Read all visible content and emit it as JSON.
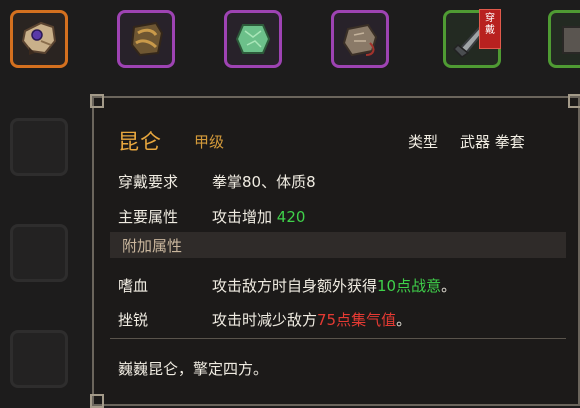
{
  "inventory": {
    "slots": [
      {
        "rarity": "orange",
        "icon": "glove-icon"
      },
      {
        "rarity": "purple",
        "icon": "armor-icon"
      },
      {
        "rarity": "purple",
        "icon": "jade-icon"
      },
      {
        "rarity": "purple",
        "icon": "pouch-icon"
      },
      {
        "rarity": "green",
        "icon": "gauntlet-blade-icon",
        "equipped_badge": "穿戴"
      },
      {
        "rarity": "green",
        "icon": "partial-item-icon"
      }
    ]
  },
  "tooltip": {
    "name": "昆仑",
    "grade": "甲级",
    "type_label": "类型",
    "type_value": "武器 拳套",
    "wear_req_label": "穿戴要求",
    "wear_req_value": "拳掌80、体质8",
    "main_attr_label": "主要属性",
    "main_attr_text": "攻击增加",
    "main_attr_value": "420",
    "extra_attr_header": "附加属性",
    "extra1_name": "嗜血",
    "extra1_text": "攻击敌方时自身额外获得",
    "extra1_highlight": "10点战意",
    "extra1_end": "。",
    "extra2_name": "挫锐",
    "extra2_text": "攻击时减少敌方",
    "extra2_highlight": "75点集气值",
    "extra2_end": "。",
    "flavor": "巍巍昆仑，擎定四方。"
  },
  "colors": {
    "name": "#e8a73e",
    "positive": "#3fd14a",
    "negative": "#e53a33",
    "orange_rarity": "#d4701f",
    "purple_rarity": "#9e43b3",
    "green_rarity": "#4f9b33"
  }
}
